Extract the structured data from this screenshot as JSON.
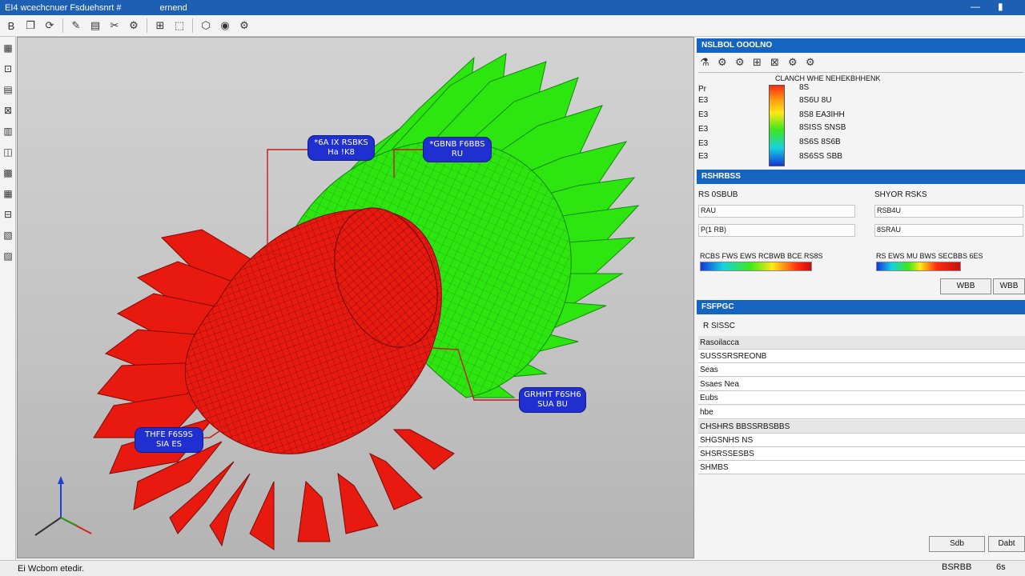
{
  "window": {
    "title": "EI4 wcechcnuer Fsduehsnrt #",
    "title_suffix": "ernend",
    "controls": [
      "—",
      "▮",
      "—"
    ]
  },
  "toolbar": {
    "items": [
      "B",
      "❐",
      "⟳",
      "✎",
      "▤",
      "✂",
      "⚙",
      "⊞",
      "⬚",
      "⬡",
      "◉",
      "⚙"
    ]
  },
  "left_tools": {
    "items": [
      "▦",
      "⊡",
      "▤",
      "⊠",
      "▥",
      "◫",
      "▩",
      "▦",
      "⊟",
      "▧",
      "▨"
    ]
  },
  "viewport": {
    "callouts": [
      {
        "line1": "*6A IX RSBKS",
        "line2": "Ha !K8"
      },
      {
        "line1": "*GBNB F6BBS",
        "line2": "RU"
      },
      {
        "line1": "GRHHT F6SH6",
        "line2": "SUA BU"
      },
      {
        "line1": "THFE F6S9S",
        "line2": "SIA ES"
      }
    ],
    "axis_labels": {
      "x": "",
      "y": "",
      "z": ""
    }
  },
  "status": {
    "left": "Ei Wcbom etedir.",
    "right_a": "BSRBB",
    "right_b": "6s"
  },
  "panel_results": {
    "title": "NSLBOL OOOLNO",
    "tools": [
      "⚗",
      "⚙",
      "⚙",
      "⊞",
      "⊠",
      "⚙",
      "⚙"
    ],
    "legend_header": "CLANCH WHE NEHEKBHHENK",
    "row_labels": [
      "Pr",
      "E3",
      "E3",
      "E3",
      "E3",
      "E3"
    ],
    "legend_values": [
      "8S",
      "8S6U 8U",
      "8S8 EA3IHH",
      "8SISS SNSB",
      "8S6S 8S6B",
      "8S6SS SBB"
    ],
    "colors": {
      "max": "#e8101a",
      "min": "#1238d8"
    }
  },
  "panel_settings": {
    "title": "RSHRBSS",
    "left_label": "RS 0SBUB",
    "right_label": "SHYOR RSKS",
    "left_inputs": [
      "RAU",
      "P(1 RB)"
    ],
    "right_inputs": [
      "RSB4U",
      "8SRAU"
    ],
    "grad_left_label": "RCBS FWS EWS RCBWB BCE RS8S",
    "grad_right_label": "RS EWS MU BWS SECBBS 6ES",
    "button_ok": "WBB",
    "button_other": "WBB"
  },
  "panel_props": {
    "title": "FSFPGC",
    "subtitle": "R  SISSC",
    "rows": [
      {
        "text": "Rasoilacca",
        "group": true
      },
      {
        "text": "SUSSSRSREONB",
        "group": false
      },
      {
        "text": "Seas",
        "group": false
      },
      {
        "text": "Ssaes Nea",
        "group": false
      },
      {
        "text": "Eubs",
        "group": false
      },
      {
        "text": "hbe",
        "group": false
      },
      {
        "text": "CHSHRS BBSSRBSBBS",
        "group": true
      },
      {
        "text": "SHGSNHS NS",
        "group": false
      },
      {
        "text": "SHSRSSESBS",
        "group": false
      },
      {
        "text": "SHMBS",
        "group": false
      }
    ],
    "btn_a": "Sdb",
    "btn_b": "Dabt"
  }
}
